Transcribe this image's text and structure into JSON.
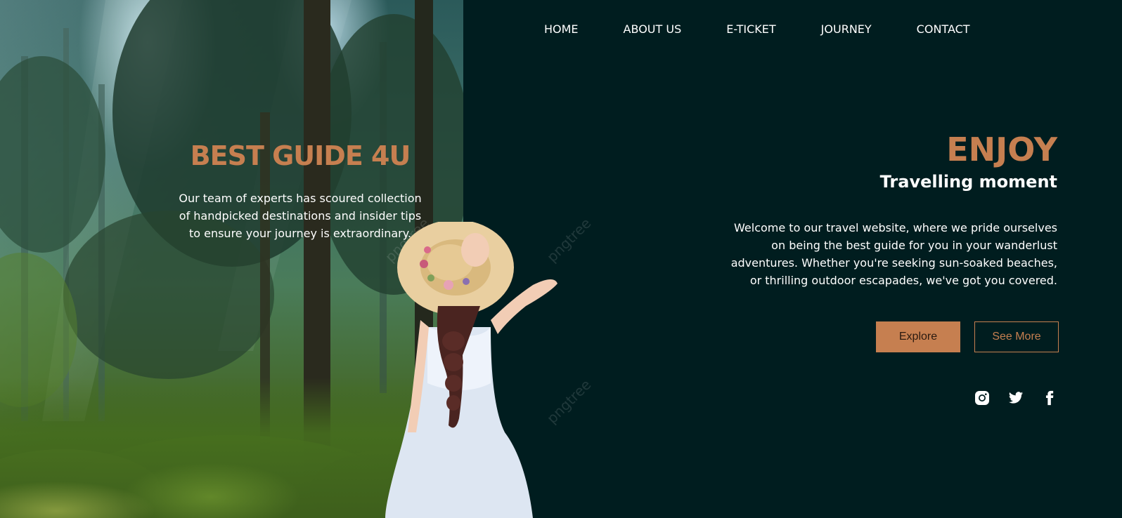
{
  "nav": {
    "items": [
      "HOME",
      "ABOUT US",
      "E-TICKET",
      "JOURNEY",
      "CONTACT"
    ]
  },
  "left_panel": {
    "title": "BEST GUIDE 4U",
    "text": "Our team of experts has scoured collection of handpicked destinations and insider tips to ensure your journey is extraordinary."
  },
  "hero": {
    "title": "ENJOY",
    "subtitle": "Travelling moment",
    "text": "Welcome to our travel website, where we pride ourselves on being the best guide for you in your wanderlust adventures. Whether you're seeking sun-soaked beaches, or thrilling outdoor escapades, we've got you covered.",
    "explore_label": "Explore",
    "see_more_label": "See More"
  },
  "socials": [
    "instagram-icon",
    "twitter-icon",
    "facebook-icon"
  ],
  "watermark": "pngtree",
  "colors": {
    "background": "#001d1f",
    "accent": "#c67f50",
    "text": "#ffffff"
  }
}
